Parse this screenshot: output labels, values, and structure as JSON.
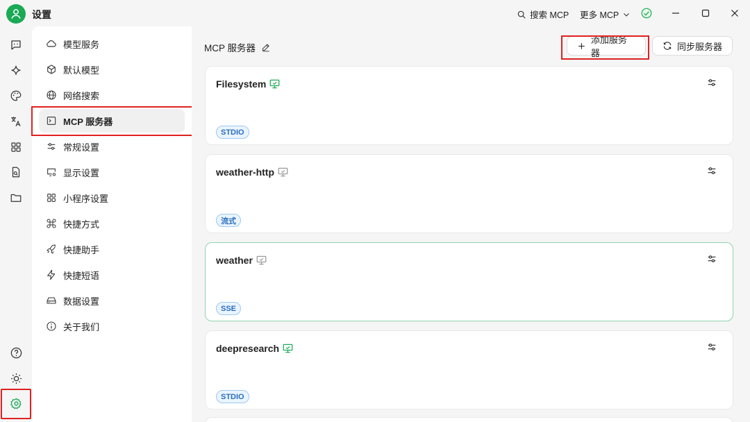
{
  "app": {
    "title": "设置"
  },
  "titlebar": {
    "search_label": "搜索 MCP",
    "more_label": "更多 MCP"
  },
  "nav": {
    "items": [
      {
        "label": "模型服务",
        "icon": "cloud-icon"
      },
      {
        "label": "默认模型",
        "icon": "cube-icon"
      },
      {
        "label": "网络搜索",
        "icon": "globe-icon"
      },
      {
        "label": "MCP 服务器",
        "icon": "terminal-icon",
        "active": true
      },
      {
        "label": "常规设置",
        "icon": "sliders-icon"
      },
      {
        "label": "显示设置",
        "icon": "monitor-gear-icon"
      },
      {
        "label": "小程序设置",
        "icon": "grid-icon"
      },
      {
        "label": "快捷方式",
        "icon": "command-icon"
      },
      {
        "label": "快捷助手",
        "icon": "rocket-icon"
      },
      {
        "label": "快捷短语",
        "icon": "zap-icon"
      },
      {
        "label": "数据设置",
        "icon": "hard-drive-icon"
      },
      {
        "label": "关于我们",
        "icon": "info-icon"
      }
    ]
  },
  "main": {
    "title": "MCP 服务器",
    "add_label": "添加服务器",
    "sync_label": "同步服务器",
    "servers": [
      {
        "name": "Filesystem",
        "tag": "STDIO",
        "active": true
      },
      {
        "name": "weather-http",
        "tag": "流式",
        "active": false
      },
      {
        "name": "weather",
        "tag": "SSE",
        "active": false
      },
      {
        "name": "deepresearch",
        "tag": "STDIO",
        "active": true
      }
    ]
  },
  "colors": {
    "brand_green": "#1aaa55",
    "highlight_red": "#e02020",
    "tag_blue": "#2a6fbd"
  }
}
